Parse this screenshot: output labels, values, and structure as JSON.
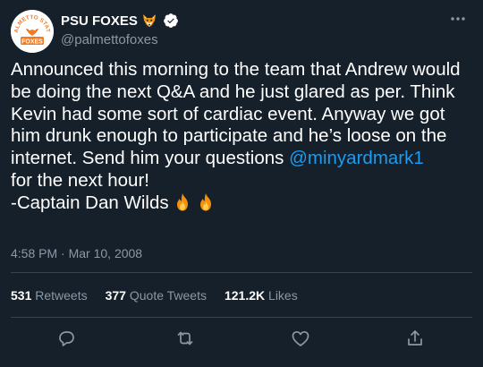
{
  "account": {
    "display_name": "PSU FOXES",
    "handle": "@palmettofoxes",
    "avatar_top_text": "PALMETTO STATE",
    "avatar_bottom_text": "FOXES",
    "name_emoji": "fox-emoji",
    "verified": true
  },
  "tweet": {
    "text_before_mention": "Announced this morning to the team that Andrew would be doing the next Q&A and he just glared as per. Think Kevin had some sort of cardiac event. Anyway we got him drunk enough to participate and he’s loose on the internet. Send him your questions ",
    "mention": "@minyardmark1",
    "text_after_mention": "\nfor the next hour!\n-Captain Dan Wilds ",
    "trailing_emoji": [
      "fire-emoji",
      "fire-emoji"
    ]
  },
  "meta": {
    "time": "4:58 PM",
    "separator": " · ",
    "date": "Mar 10, 2008"
  },
  "stats": {
    "retweets_count": "531",
    "retweets_label": " Retweets",
    "quote_count": "377",
    "quote_label": " Quote Tweets",
    "likes_count": "121.2K",
    "likes_label": " Likes"
  },
  "colors": {
    "background": "#15202b",
    "text": "#ffffff",
    "secondary_text": "#8b98a5",
    "accent": "#1d9bf0",
    "divider": "#38444d",
    "brand_orange": "#f47a20"
  },
  "actions": [
    "reply-icon",
    "retweet-icon",
    "like-icon",
    "share-icon"
  ]
}
